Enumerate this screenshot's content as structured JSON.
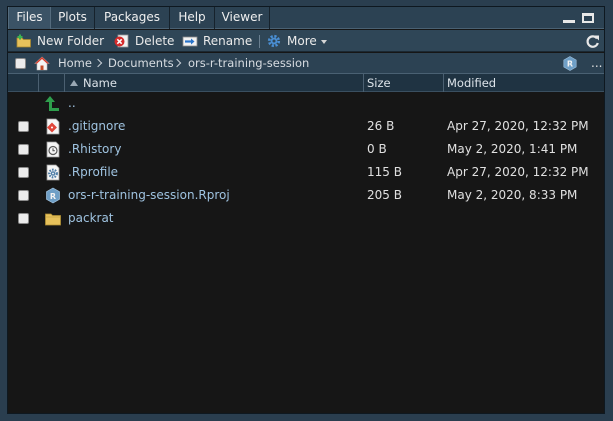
{
  "tabs": [
    {
      "label": "Files"
    },
    {
      "label": "Plots"
    },
    {
      "label": "Packages"
    },
    {
      "label": "Help"
    },
    {
      "label": "Viewer"
    }
  ],
  "toolbar": {
    "new_folder": "New Folder",
    "delete": "Delete",
    "rename": "Rename",
    "more": "More"
  },
  "breadcrumb": {
    "home": "Home",
    "items": [
      "Documents",
      "ors-r-training-session"
    ],
    "overflow": "..."
  },
  "columns": {
    "name": "Name",
    "size": "Size",
    "modified": "Modified"
  },
  "files": [
    {
      "name": "..",
      "size": "",
      "modified": "",
      "icon": "up-arrow-icon"
    },
    {
      "name": ".gitignore",
      "size": "26 B",
      "modified": "Apr 27, 2020, 12:32 PM",
      "icon": "git-file-icon"
    },
    {
      "name": ".Rhistory",
      "size": "0 B",
      "modified": "May 2, 2020, 1:41 PM",
      "icon": "history-file-icon"
    },
    {
      "name": ".Rprofile",
      "size": "115 B",
      "modified": "Apr 27, 2020, 12:32 PM",
      "icon": "settings-file-icon"
    },
    {
      "name": "ors-r-training-session.Rproj",
      "size": "205 B",
      "modified": "May 2, 2020, 8:33 PM",
      "icon": "rproj-file-icon"
    },
    {
      "name": "packrat",
      "size": "",
      "modified": "",
      "icon": "folder-icon"
    }
  ],
  "colors": {
    "pane_bg": "#161616",
    "chrome_bg": "#2c4253",
    "link": "#9fc3e0",
    "up_arrow": "#2e9e4c",
    "folder": "#e6c15b"
  }
}
